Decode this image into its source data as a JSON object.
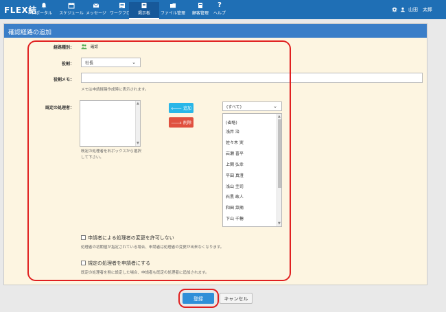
{
  "header": {
    "brand": "FLEX結",
    "nav": [
      {
        "label": "ポータル",
        "icon": "bell-icon"
      },
      {
        "label": "スケジュール",
        "icon": "calendar-icon"
      },
      {
        "label": "メッセージ",
        "icon": "envelope-icon"
      },
      {
        "label": "ワークフロー",
        "icon": "workflow-icon"
      },
      {
        "label": "掲示板",
        "icon": "bulletin-icon"
      },
      {
        "label": "ファイル管理",
        "icon": "folder-icon"
      },
      {
        "label": "顧客管理",
        "icon": "customer-icon"
      },
      {
        "label": "ヘルプ",
        "icon": "question-icon"
      }
    ],
    "user_name": "山田　太郎"
  },
  "panel": {
    "title": "確認経路の追加",
    "route_type_label": "経路種別：",
    "route_type_value": "確認",
    "role_label": "役割：",
    "role_value": "社長",
    "role_memo_label": "役割メモ：",
    "role_memo_value": "",
    "role_memo_hint": "メモは申請経路作成時に表示されます。",
    "default_handler_label": "既定の処理者：",
    "left_list_hint": "既定の処理者を右ボックスから選択して下さい。",
    "add_button": "追加",
    "remove_button": "削除",
    "filter_value": "(すべて)",
    "handlers": [
      "(省略)",
      "浅井 治",
      "佐々木 実",
      "岩瀬 喜平",
      "上関 弘幸",
      "平田 真澄",
      "浅山 圭司",
      "石黒 政人",
      "和田 菜摘",
      "下山 千穂"
    ],
    "checkbox1_label": "申請者による処理者の変更を許可しない",
    "checkbox1_hint": "処理者の初期値が指定されている場合、申請者は処理者の変更が出来なくなります。",
    "checkbox2_label": "規定の処理者を申請者にする",
    "checkbox2_hint": "既定の処理者を削に設定した場合、申請者も既定の処理者に追加されます。"
  },
  "footer": {
    "submit_label": "登録",
    "cancel_label": "キャンセル"
  },
  "colors": {
    "navbar": "#1f6fb5",
    "panel_header": "#3a7ec8",
    "panel_bg": "#fdf5e1",
    "highlight": "#e02020",
    "add": "#29b6e8",
    "remove": "#e0503f"
  }
}
